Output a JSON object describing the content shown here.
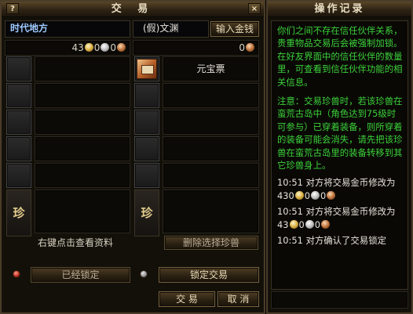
{
  "trade_window": {
    "title": "交 易",
    "help_label": "?",
    "close_label": "×",
    "my_name": "时代地方",
    "partner_name": "(假)文渊",
    "input_money_label": "输入金钱",
    "my_money": {
      "gold": "43",
      "silver": "0",
      "copper": "0"
    },
    "partner_money": {
      "copper": "0"
    },
    "partner_items": [
      {
        "name": "元宝票",
        "icon": "gold-ticket-icon"
      }
    ],
    "pet_slot_label": "珍",
    "pet_hint": "右键点击查看资料",
    "delete_pet_label": "删除选择珍兽",
    "locked_label": "已经锁定",
    "lock_trade_label": "锁定交易",
    "trade_label": "交 易",
    "cancel_label": "取 消"
  },
  "log_window": {
    "title": "操作记录",
    "intro": "你们之间不存在信任伙伴关系，贵重物品交易后会被强制加锁。在好友界面中的信任伙伴的数量里，可查看到信任伙伴功能的相关信息。",
    "warning": "注意：交易珍兽时，若该珍兽在蛮荒古岛中（角色达到75级时可参与）已穿着装备，则所穿着的装备可能会消失，请先把该珍兽在蛮荒古岛里的装备转移到其它珍兽身上。",
    "entries": [
      {
        "time": "10:51",
        "text": "对方将交易金币修改为",
        "gold": "430",
        "silver": "0",
        "copper": "0"
      },
      {
        "time": "10:51",
        "text": "对方将交易金币修改为",
        "gold": "43",
        "silver": "0",
        "copper": "0"
      },
      {
        "time": "10:51",
        "text": "对方确认了交易锁定"
      }
    ]
  },
  "colors": {
    "green_text": "#3bd23b",
    "name_blue": "#9ec9ff",
    "gold_text": "#e7cf8f"
  }
}
